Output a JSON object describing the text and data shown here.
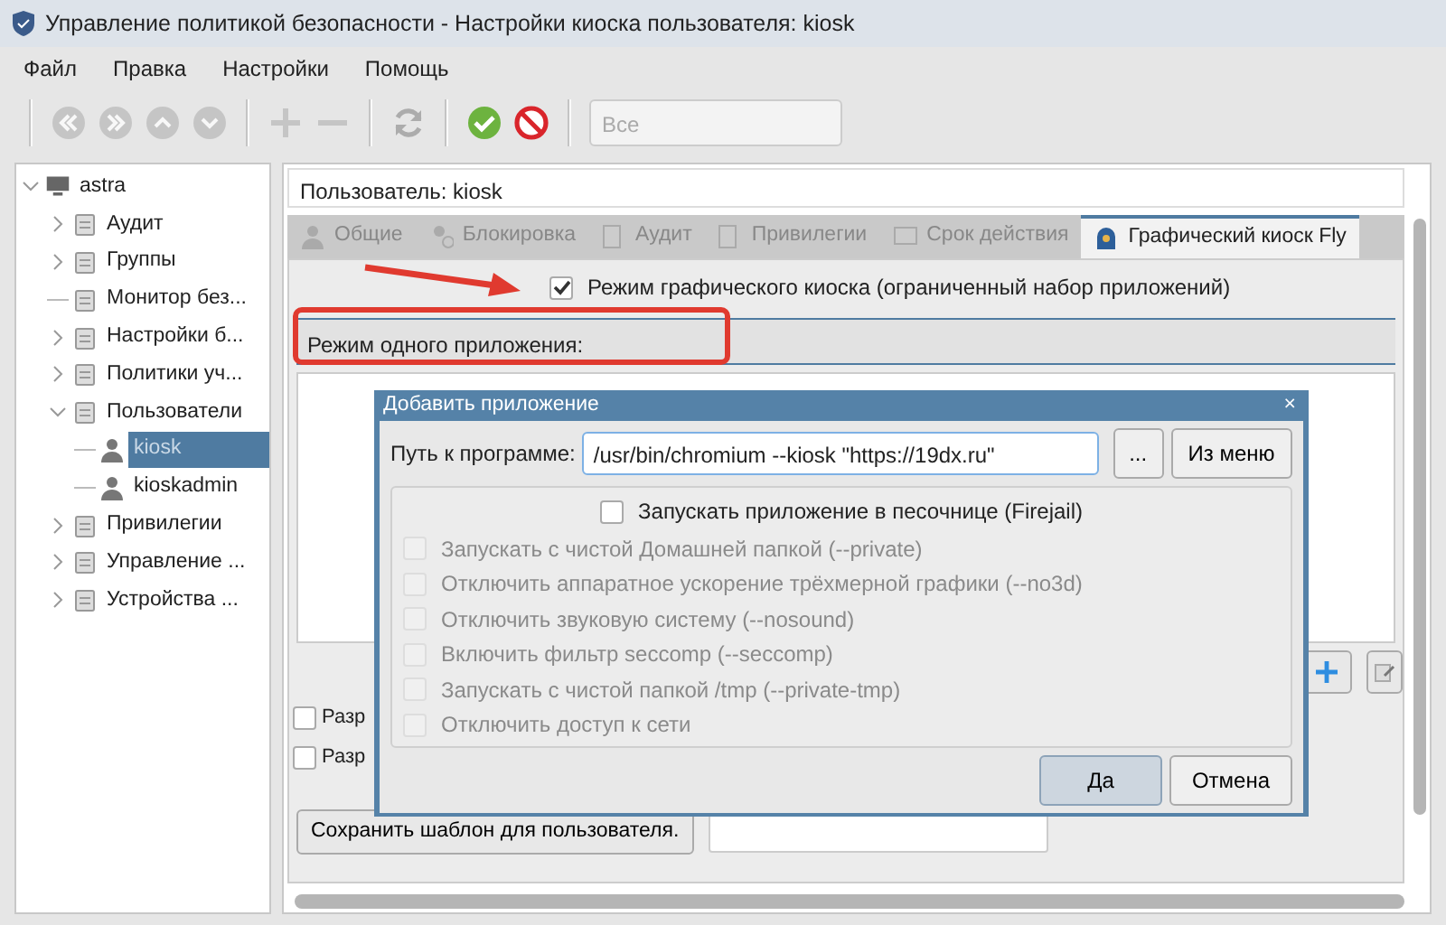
{
  "window": {
    "title": "Управление политикой безопасности - Настройки киоска пользователя: kiosk"
  },
  "menu": [
    "Файл",
    "Правка",
    "Настройки",
    "Помощь"
  ],
  "toolbar": [
    {
      "kind": "first",
      "disabled": true
    },
    {
      "kind": "last",
      "disabled": true
    },
    {
      "kind": "up",
      "disabled": true
    },
    {
      "kind": "down",
      "disabled": true
    },
    {
      "kind": "sep"
    },
    {
      "kind": "add",
      "disabled": true
    },
    {
      "kind": "remove",
      "disabled": true
    },
    {
      "kind": "sep"
    },
    {
      "kind": "refresh",
      "disabled": true
    },
    {
      "kind": "sep"
    },
    {
      "kind": "apply",
      "disabled": false
    },
    {
      "kind": "cancel",
      "disabled": false
    },
    {
      "kind": "sep"
    }
  ],
  "filter": {
    "value": "Все",
    "disabled": true
  },
  "tree": {
    "label": "astra",
    "expanded": true,
    "selected": false,
    "children": [
      {
        "label": "Аудит",
        "expandable": true,
        "expanded": false,
        "selected": false
      },
      {
        "label": "Группы",
        "expandable": true,
        "expanded": false,
        "selected": false
      },
      {
        "label": "Монитор без...",
        "expandable": false,
        "selected": false
      },
      {
        "label": "Настройки б...",
        "expandable": true,
        "expanded": false,
        "selected": false
      },
      {
        "label": "Политики уч...",
        "expandable": true,
        "expanded": false,
        "selected": false
      },
      {
        "label": "Пользователи",
        "expandable": true,
        "expanded": true,
        "selected": false,
        "children": [
          {
            "label": "kiosk",
            "expandable": false,
            "selected": true
          },
          {
            "label": "kioskadmin",
            "expandable": false,
            "selected": false
          }
        ]
      },
      {
        "label": "Привилегии",
        "expandable": true,
        "expanded": false,
        "selected": false
      },
      {
        "label": "Управление ...",
        "expandable": true,
        "expanded": false,
        "selected": false
      },
      {
        "label": "Устройства ...",
        "expandable": true,
        "expanded": false,
        "selected": false
      }
    ]
  },
  "user_field": "Пользователь: kiosk",
  "tabs": [
    {
      "label": "Общие",
      "selected": false
    },
    {
      "label": "Блокировка",
      "selected": false
    },
    {
      "label": "Аудит",
      "selected": false
    },
    {
      "label": "Привилегии",
      "selected": false
    },
    {
      "label": "Срок действия",
      "selected": false
    },
    {
      "label": "Графический киоск Fly",
      "selected": true
    }
  ],
  "kiosk_mode": {
    "label": "Режим графического киоска (ограниченный набор приложений)",
    "checked": true
  },
  "single_app_header": "Режим одного приложения:",
  "options": [
    {
      "label": "Разр",
      "checked": false
    },
    {
      "label": "Разр",
      "checked": false
    }
  ],
  "save_template_button": "Сохранить шаблон для пользователя.",
  "dialog": {
    "title": "Добавить приложение",
    "close": "×",
    "path_label": "Путь к программе:",
    "path_value": "/usr/bin/chromium --kiosk \"https://19dx.ru\"",
    "browse_button": "...",
    "menu_button": "Из меню",
    "sandbox": {
      "label": "Запускать приложение в песочнице (Firejail)",
      "checked": false
    },
    "sandbox_options": [
      {
        "label": "Запускать с чистой Домашней папкой (--private)",
        "checked": false,
        "disabled": true
      },
      {
        "label": "Отключить аппаратное ускорение трёхмерной графики (--no3d)",
        "checked": false,
        "disabled": true
      },
      {
        "label": "Отключить звуковую систему (--nosound)",
        "checked": false,
        "disabled": true
      },
      {
        "label": "Включить фильтр seccomp (--seccomp)",
        "checked": false,
        "disabled": true
      },
      {
        "label": "Запускать с чистой папкой /tmp (--private-tmp)",
        "checked": false,
        "disabled": true
      },
      {
        "label": "Отключить доступ к сети",
        "checked": false,
        "disabled": true
      }
    ],
    "buttons": [
      {
        "label": "Да",
        "default": true
      },
      {
        "label": "Отмена",
        "default": false
      }
    ]
  }
}
